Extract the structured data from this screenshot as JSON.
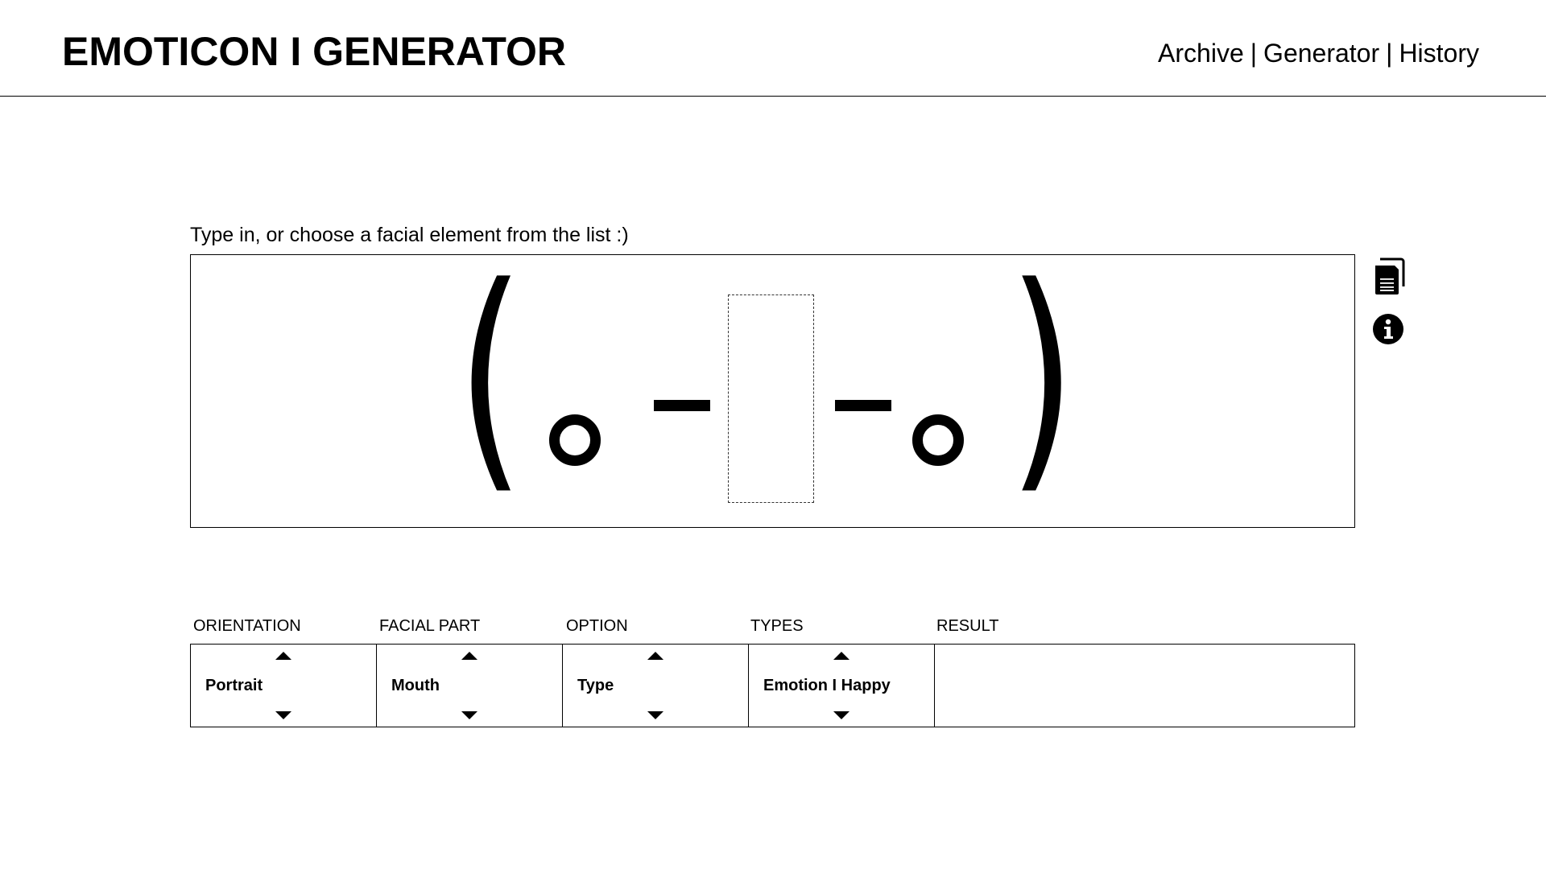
{
  "header": {
    "title": "EMOTICON I GENERATOR",
    "nav": [
      {
        "label": "Archive"
      },
      {
        "label": "Generator"
      },
      {
        "label": "History"
      }
    ],
    "separator": "|"
  },
  "editor": {
    "prompt": "Type in, or choose a facial element from the list :)",
    "face": {
      "left_paren": "(",
      "right_paren": ")"
    }
  },
  "side_icons": [
    {
      "icon": "copy-document-icon"
    },
    {
      "icon": "info-icon"
    }
  ],
  "selectors": {
    "columns": [
      {
        "label": "ORIENTATION",
        "value": "Portrait"
      },
      {
        "label": "FACIAL PART",
        "value": "Mouth"
      },
      {
        "label": "OPTION",
        "value": "Type"
      },
      {
        "label": "TYPES",
        "value": "Emotion I Happy"
      },
      {
        "label": "RESULT",
        "value": ""
      }
    ]
  }
}
